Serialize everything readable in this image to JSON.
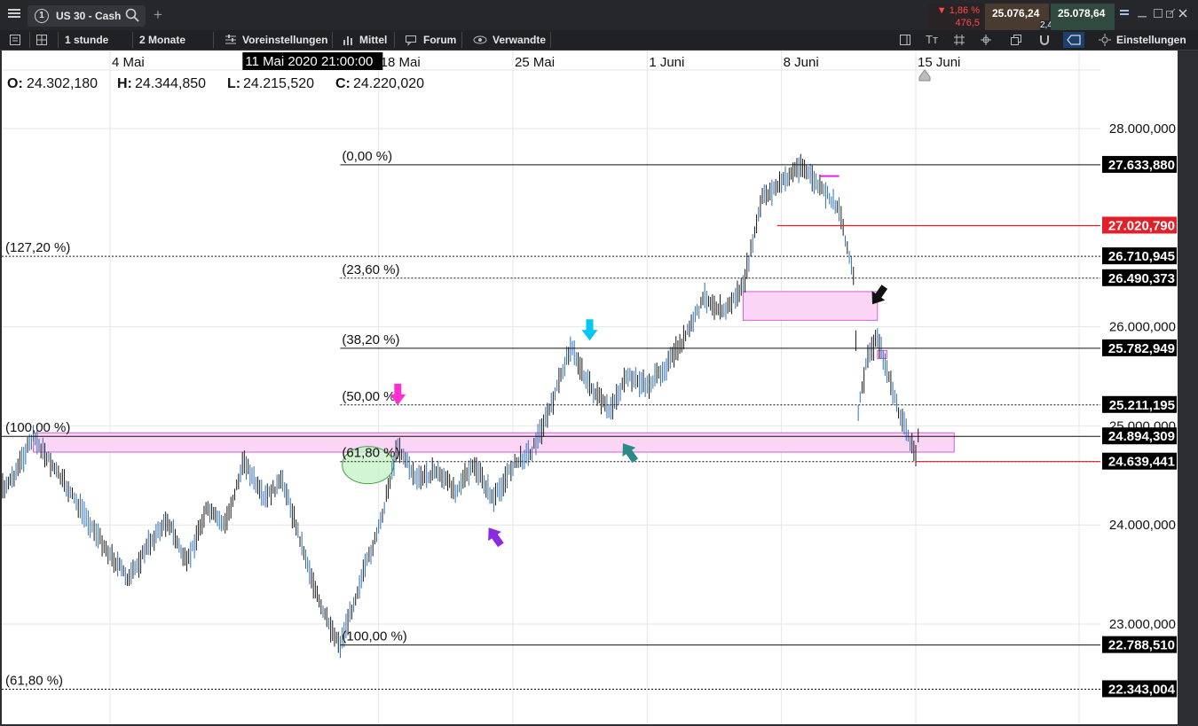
{
  "toolbar": {
    "menu_icon": "hamburger-icon",
    "tab_number": "1",
    "instrument": "US 30 - Cash",
    "search_icon": "search-icon",
    "add_tab": "+",
    "change_pct": "▼ 1,86 %",
    "change_pts": "476,5",
    "bid": "25.076,24",
    "spread": "2,40",
    "ask": "25.078,64",
    "window_controls": [
      "tile-icon",
      "minimize-icon",
      "expand-icon",
      "popout-icon",
      "close-icon"
    ]
  },
  "toolbar2": {
    "interval": "1 stunde",
    "range": "2 Monate",
    "presets": "Voreinstellungen",
    "indicators": "Mittel",
    "forum": "Forum",
    "related": "Verwandte",
    "settings": "Einstellungen"
  },
  "ohlc": {
    "o_label": "O:",
    "o": "24.302,180",
    "h_label": "H:",
    "h": "24.344,850",
    "l_label": "L:",
    "l": "24.215,520",
    "c_label": "C:",
    "c": "24.220,020"
  },
  "crosshair_date": "11 Mai 2020 21:00:00",
  "colors": {
    "background": "#ffffff",
    "candles": "#1a1a1a",
    "wick_blue": "#2f6fb6",
    "zone_fill": "#fbd5f6",
    "zone_border": "#d35fd0",
    "red_line": "#e0212a",
    "magenta_line": "#e61fd8",
    "price_label_bg": "#000000",
    "price_label_red_bg": "#e0212a"
  },
  "chart_data": {
    "type": "line",
    "subtype": "candlestick",
    "timeframe": "1 stunde",
    "x_axis_labels": [
      "4 Mai",
      "18 Mai",
      "25 Mai",
      "1 Juni",
      "8 Juni",
      "15 Juni"
    ],
    "y_ticks": [
      "28.000,000",
      "26.000,000",
      "25.000,000",
      "24.000,000",
      "23.000,000"
    ],
    "y_tick_values": [
      28000,
      26000,
      25000,
      24000,
      23000
    ],
    "ylim": [
      22000,
      28600
    ],
    "grid": true,
    "price_path": [
      [
        "27 Apr",
        24050
      ],
      [
        "29 Apr",
        24500
      ],
      [
        "30 Apr",
        24890
      ],
      [
        "1 Mai",
        24600
      ],
      [
        "4 Mai",
        23700
      ],
      [
        "5 Mai",
        23450
      ],
      [
        "6 Mai",
        23800
      ],
      [
        "7 Mai",
        24050
      ],
      [
        "8 Mai",
        23600
      ],
      [
        "9 Mai",
        24150
      ],
      [
        "10 Mai",
        24000
      ],
      [
        "11 Mai",
        24650
      ],
      [
        "12 Mai",
        24250
      ],
      [
        "13 Mai",
        24450
      ],
      [
        "14 Mai",
        23800
      ],
      [
        "15 Mai",
        23150
      ],
      [
        "16 Mai",
        22790
      ],
      [
        "17 Mai",
        23400
      ],
      [
        "18 Mai",
        23950
      ],
      [
        "19 Mai",
        24800
      ],
      [
        "20 Mai",
        24450
      ],
      [
        "21 Mai",
        24550
      ],
      [
        "22 Mai",
        24350
      ],
      [
        "23 Mai",
        24600
      ],
      [
        "24 Mai",
        24250
      ],
      [
        "25 Mai",
        24600
      ],
      [
        "26 Mai",
        24750
      ],
      [
        "27 Mai",
        25200
      ],
      [
        "28 Mai",
        25800
      ],
      [
        "29 Mai",
        25400
      ],
      [
        "30 Mai",
        25150
      ],
      [
        "31 Mai",
        25500
      ],
      [
        "1 Juni",
        25400
      ],
      [
        "2 Juni",
        25600
      ],
      [
        "3 Juni",
        25900
      ],
      [
        "4 Juni",
        26300
      ],
      [
        "5 Juni",
        26150
      ],
      [
        "6 Juni",
        26400
      ],
      [
        "7 Juni",
        27300
      ],
      [
        "8 Juni",
        27450
      ],
      [
        "9 Juni",
        27633
      ],
      [
        "10 Juni",
        27400
      ],
      [
        "11 Juni",
        27200
      ],
      [
        "11 Juni 18h",
        26500
      ],
      [
        "12 Juni",
        25150
      ],
      [
        "12 Juni 12h",
        25700
      ],
      [
        "13 Juni",
        25900
      ],
      [
        "14 Juni",
        25200
      ],
      [
        "15 Juni",
        24700
      ],
      [
        "15 Juni 06h",
        25100
      ]
    ],
    "fib_left": [
      {
        "label": "(127,20 %)",
        "value": 26710.945
      },
      {
        "label": "(100,00 %)",
        "value": 24894.309
      },
      {
        "label": "(61,80 %)",
        "value": 22343.004
      }
    ],
    "fib_retracement": [
      {
        "label": "(0,00 %)",
        "value": 27633.88
      },
      {
        "label": "(23,60 %)",
        "value": 26490.373
      },
      {
        "label": "(38,20 %)",
        "value": 25782.949
      },
      {
        "label": "(50,00 %)",
        "value": 25211.195
      },
      {
        "label": "(61,80 %)",
        "value": 24639.441
      },
      {
        "label": "(100,00 %)",
        "value": 22788.51
      }
    ],
    "price_labels": [
      {
        "text": "27.633,880",
        "value": 27633.88,
        "red": false
      },
      {
        "text": "27.020,790",
        "value": 27020.79,
        "red": true
      },
      {
        "text": "26.710,945",
        "value": 26710.945,
        "red": false
      },
      {
        "text": "26.490,373",
        "value": 26490.373,
        "red": false
      },
      {
        "text": "25.782,949",
        "value": 25782.949,
        "red": false
      },
      {
        "text": "25.211,195",
        "value": 25211.195,
        "red": false
      },
      {
        "text": "24.894,309",
        "value": 24894.309,
        "red": false
      },
      {
        "text": "24.639,441",
        "value": 24639.441,
        "red": false
      },
      {
        "text": "22.788,510",
        "value": 22788.51,
        "red": false
      },
      {
        "text": "22.343,004",
        "value": 22343.004,
        "red": false
      }
    ],
    "zones": [
      {
        "from": "30 Apr",
        "to": "17 Juni",
        "low": 24735,
        "high": 24930
      },
      {
        "from": "6 Juni",
        "to": "13 Juni",
        "low": 26065,
        "high": 26355
      },
      {
        "from": "13 Juni",
        "to": "13 Juni 12h",
        "low": 25680,
        "high": 25760
      }
    ],
    "markers": [
      {
        "color": "#00c8f0",
        "direction": "down",
        "at": "29 Mai"
      },
      {
        "color": "#ff2fd0",
        "direction": "down",
        "at": "19 Mai"
      },
      {
        "color": "#2a8a8a",
        "direction": "up",
        "at": "31 Mai"
      },
      {
        "color": "#8a2be2",
        "direction": "up",
        "at": "24 Mai"
      },
      {
        "color": "#111111",
        "direction": "down",
        "at": "13 Juni"
      }
    ],
    "ellipse_at": "18 Mai"
  }
}
